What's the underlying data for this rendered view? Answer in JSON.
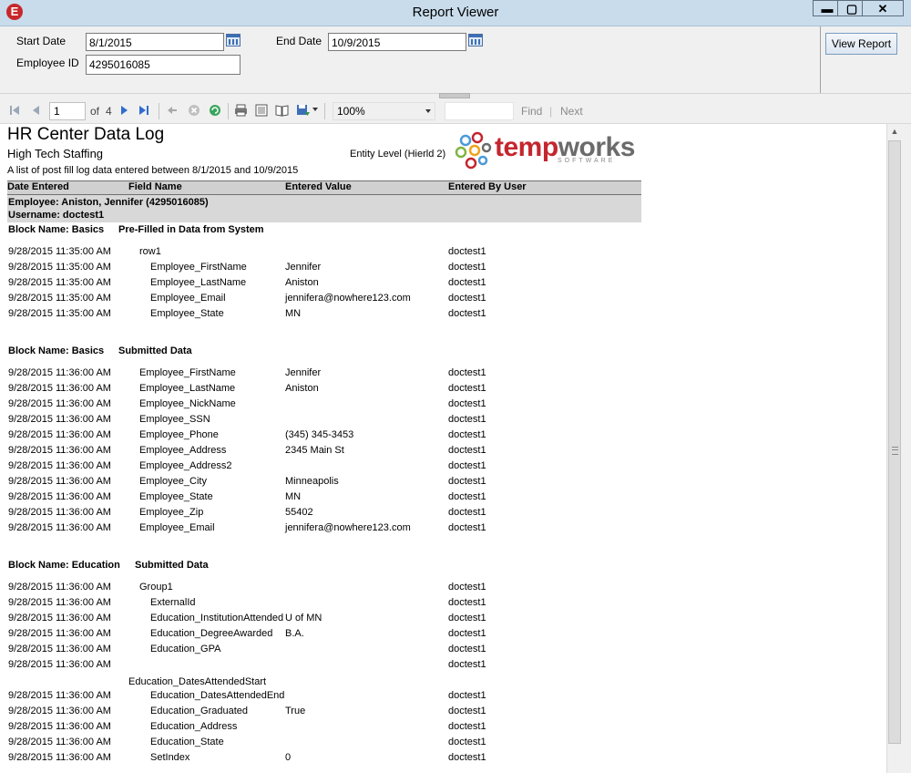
{
  "window": {
    "title": "Report Viewer",
    "app_icon": "e-app-icon",
    "minimize": "▬",
    "maximize": "▢",
    "close": "✕"
  },
  "params": {
    "start_date_label": "Start Date",
    "start_date_value": "8/1/2015",
    "end_date_label": "End Date",
    "end_date_value": "10/9/2015",
    "employee_id_label": "Employee ID",
    "employee_id_value": "4295016085",
    "view_report_label": "View Report"
  },
  "toolbar": {
    "page_value": "1",
    "of_label": "of",
    "total_pages": "4",
    "zoom_value": "100%",
    "find_label": "Find",
    "next_label": "Next"
  },
  "report": {
    "title": "HR Center Data Log",
    "company": "High Tech Staffing",
    "entity_level": "Entity Level (Hierld 2)",
    "description": "A list of post fill log data entered between 8/1/2015 and 10/9/2015",
    "logo_temp": "temp",
    "logo_works": "works",
    "logo_sub": "SOFTWARE",
    "columns": [
      "Date Entered",
      "Field Name",
      "Entered Value",
      "Entered By User"
    ],
    "employee_line": "Employee: Aniston, Jennifer (4295016085)",
    "username_line": "Username: doctest1",
    "blocks": [
      {
        "name": "Block Name: Basics",
        "kind": "Pre-Filled in Data from System",
        "rows": [
          {
            "date": "9/28/2015 11:35:00 AM",
            "field": "row1",
            "value": "",
            "user": "doctest1"
          },
          {
            "date": "9/28/2015 11:35:00 AM",
            "field": "Employee_FirstName",
            "value": "Jennifer",
            "user": "doctest1"
          },
          {
            "date": "9/28/2015 11:35:00 AM",
            "field": "Employee_LastName",
            "value": "Aniston",
            "user": "doctest1"
          },
          {
            "date": "9/28/2015 11:35:00 AM",
            "field": "Employee_Email",
            "value": "jennifera@nowhere123.com",
            "user": "doctest1"
          },
          {
            "date": "9/28/2015 11:35:00 AM",
            "field": "Employee_State",
            "value": "MN",
            "user": "doctest1"
          }
        ]
      },
      {
        "name": "Block Name: Basics",
        "kind": "Submitted Data",
        "rows": [
          {
            "date": "9/28/2015 11:36:00 AM",
            "field": "Employee_FirstName",
            "value": "Jennifer",
            "user": "doctest1"
          },
          {
            "date": "9/28/2015 11:36:00 AM",
            "field": "Employee_LastName",
            "value": "Aniston",
            "user": "doctest1"
          },
          {
            "date": "9/28/2015 11:36:00 AM",
            "field": "Employee_NickName",
            "value": "",
            "user": "doctest1"
          },
          {
            "date": "9/28/2015 11:36:00 AM",
            "field": "Employee_SSN",
            "value": "",
            "user": "doctest1"
          },
          {
            "date": "9/28/2015 11:36:00 AM",
            "field": "Employee_Phone",
            "value": "(345) 345-3453",
            "user": "doctest1"
          },
          {
            "date": "9/28/2015 11:36:00 AM",
            "field": "Employee_Address",
            "value": "2345 Main St",
            "user": "doctest1"
          },
          {
            "date": "9/28/2015 11:36:00 AM",
            "field": "Employee_Address2",
            "value": "",
            "user": "doctest1"
          },
          {
            "date": "9/28/2015 11:36:00 AM",
            "field": "Employee_City",
            "value": "Minneapolis",
            "user": "doctest1"
          },
          {
            "date": "9/28/2015 11:36:00 AM",
            "field": "Employee_State",
            "value": "MN",
            "user": "doctest1"
          },
          {
            "date": "9/28/2015 11:36:00 AM",
            "field": "Employee_Zip",
            "value": "55402",
            "user": "doctest1"
          },
          {
            "date": "9/28/2015 11:36:00 AM",
            "field": "Employee_Email",
            "value": "jennifera@nowhere123.com",
            "user": "doctest1"
          }
        ]
      },
      {
        "name": "Block Name: Education",
        "kind": "Submitted Data",
        "rows": [
          {
            "date": "9/28/2015 11:36:00 AM",
            "field": "Group1",
            "value": "",
            "user": "doctest1"
          },
          {
            "date": "9/28/2015 11:36:00 AM",
            "field": "ExternalId",
            "value": "",
            "user": "doctest1"
          },
          {
            "date": "9/28/2015 11:36:00 AM",
            "field": "Education_InstitutionAttended",
            "value": "U of MN",
            "user": "doctest1"
          },
          {
            "date": "9/28/2015 11:36:00 AM",
            "field": "Education_DegreeAwarded",
            "value": "B.A.",
            "user": "doctest1"
          },
          {
            "date": "9/28/2015 11:36:00 AM",
            "field": "Education_GPA",
            "value": "",
            "user": "doctest1"
          },
          {
            "date": "9/28/2015 11:36:00 AM",
            "field": "",
            "value": "",
            "user": "doctest1"
          },
          {
            "date": "",
            "field": "Education_DatesAttendedStart",
            "value": "",
            "user": ""
          },
          {
            "date": "9/28/2015 11:36:00 AM",
            "field": "Education_DatesAttendedEnd",
            "value": "",
            "user": "doctest1"
          },
          {
            "date": "9/28/2015 11:36:00 AM",
            "field": "Education_Graduated",
            "value": "True",
            "user": "doctest1"
          },
          {
            "date": "9/28/2015 11:36:00 AM",
            "field": "Education_Address",
            "value": "",
            "user": "doctest1"
          },
          {
            "date": "9/28/2015 11:36:00 AM",
            "field": "Education_State",
            "value": "",
            "user": "doctest1"
          },
          {
            "date": "9/28/2015 11:36:00 AM",
            "field": "SetIndex",
            "value": "0",
            "user": "doctest1"
          }
        ]
      }
    ]
  }
}
